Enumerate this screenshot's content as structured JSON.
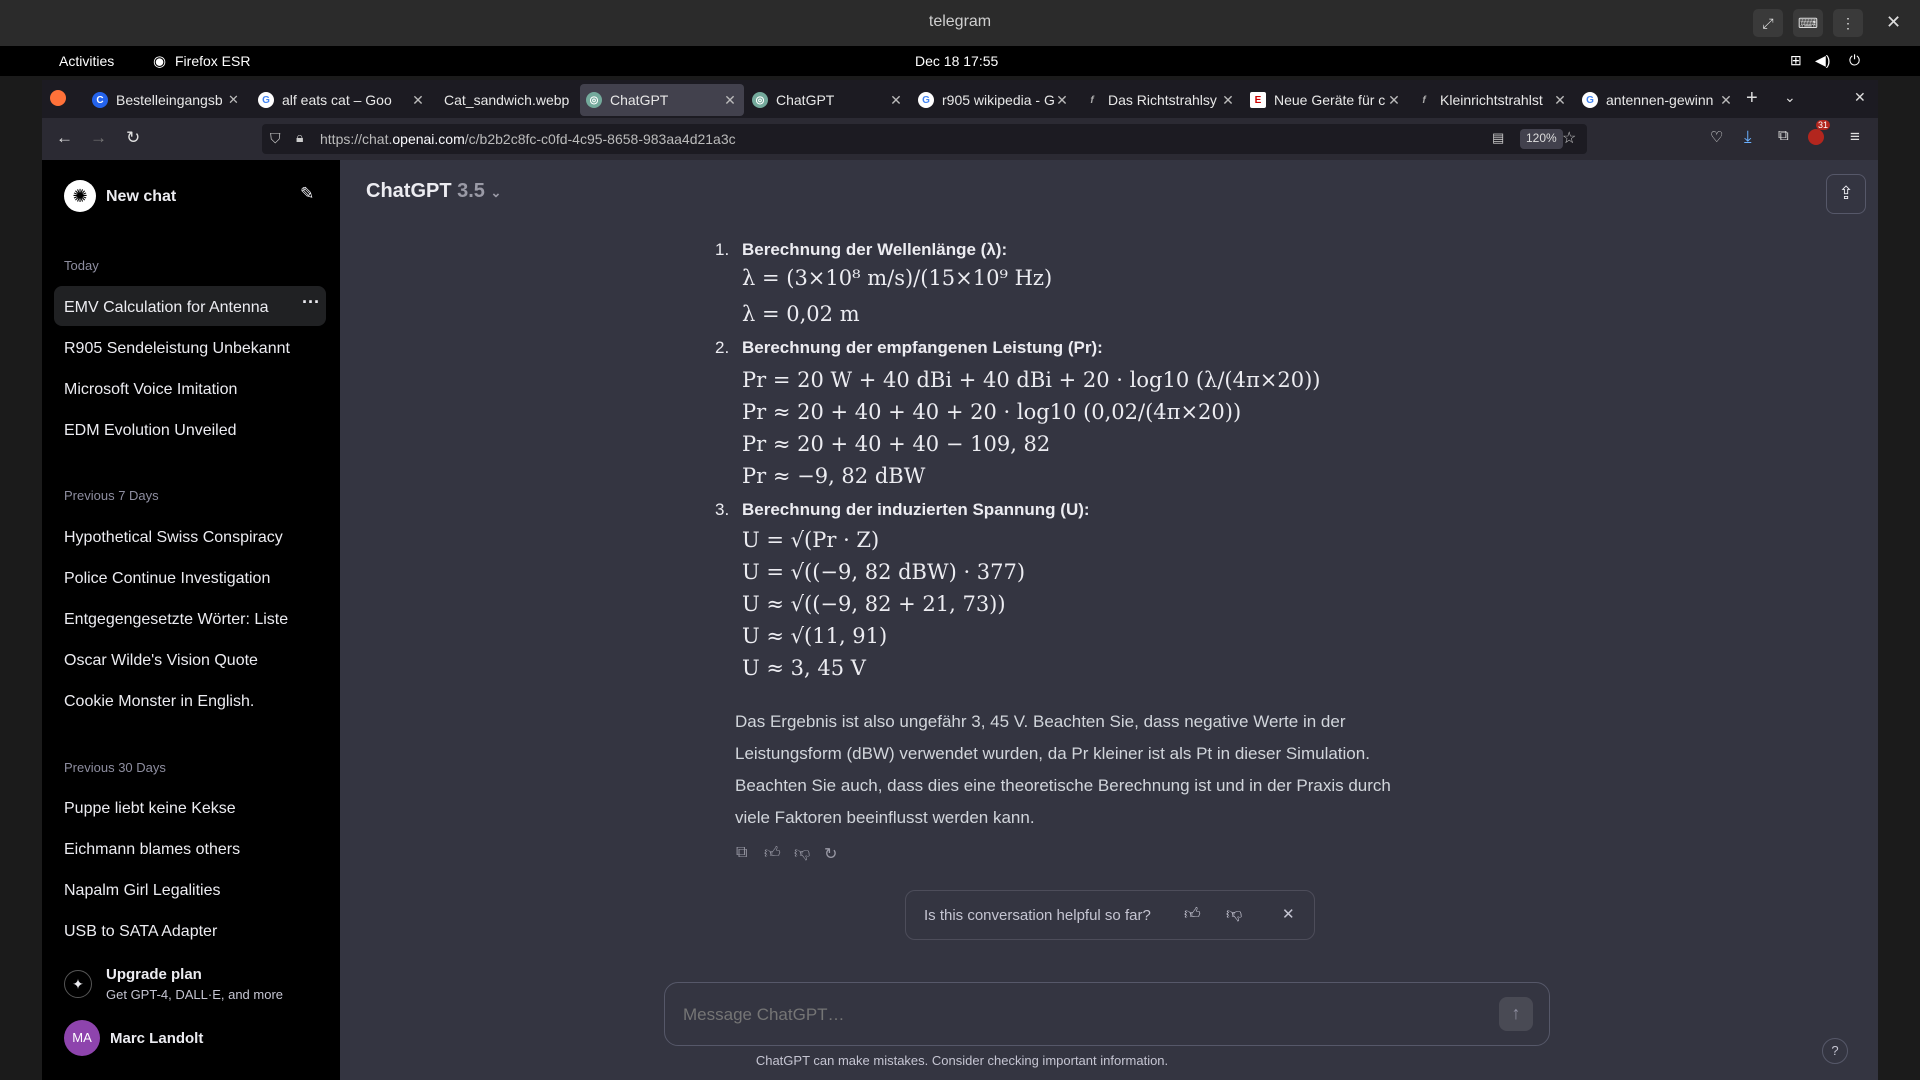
{
  "window": {
    "title": "telegram"
  },
  "gnome": {
    "activities": "Activities",
    "app": "Firefox ESR",
    "clock": "Dec 18  17:55"
  },
  "tabs": [
    {
      "label": "Bestelleingangsb",
      "icon": "firefox-icon"
    },
    {
      "label": "alf eats cat – Goo",
      "icon": "google-icon"
    },
    {
      "label": "Cat_sandwich.webp",
      "icon": "image-icon"
    },
    {
      "label": "ChatGPT",
      "icon": "chatgpt-icon",
      "active": true
    },
    {
      "label": "ChatGPT",
      "icon": "chatgpt-icon"
    },
    {
      "label": "r905 wikipedia - G",
      "icon": "google-icon"
    },
    {
      "label": "Das Richtstrahlsy",
      "icon": "f-icon"
    },
    {
      "label": "Neue Geräte für c",
      "icon": "e-icon"
    },
    {
      "label": "Kleinrichtstrahlst",
      "icon": "f-icon"
    },
    {
      "label": "antennen-gewinn",
      "icon": "google-icon"
    }
  ],
  "nav": {
    "url_prefix": "https://chat.",
    "url_host": "openai.com",
    "url_path": "/c/b2b2c8fc-c0fd-4c95-8658-983aa4d21a3c",
    "zoom": "120%",
    "badge": "31"
  },
  "sidebar": {
    "new_chat": "New chat",
    "sections": [
      {
        "heading": "Today",
        "items": [
          "EMV Calculation for Antenna",
          "R905 Sendeleistung Unbekannt",
          "Microsoft Voice Imitation",
          "EDM Evolution Unveiled"
        ]
      },
      {
        "heading": "Previous 7 Days",
        "items": [
          "Hypothetical Swiss Conspiracy",
          "Police Continue Investigation",
          "Entgegengesetzte Wörter: Liste",
          "Oscar Wilde's Vision Quote",
          "Cookie Monster in English."
        ]
      },
      {
        "heading": "Previous 30 Days",
        "items": [
          "Puppe liebt keine Kekse",
          "Eichmann blames others",
          "Napalm Girl Legalities",
          "USB to SATA Adapter"
        ]
      }
    ],
    "upgrade_title": "Upgrade plan",
    "upgrade_sub": "Get GPT-4, DALL·E, and more",
    "avatar_initials": "MA",
    "user_name": "Marc Landolt"
  },
  "header": {
    "model": "ChatGPT",
    "version": "3.5"
  },
  "steps": [
    {
      "num": "1.",
      "title": "Berechnung der Wellenlänge (λ):",
      "lines": [
        "λ = (3×10⁸ m/s)/(15×10⁹ Hz)",
        "λ = 0,02 m"
      ]
    },
    {
      "num": "2.",
      "title": "Berechnung der empfangenen Leistung (Pr):",
      "lines": [
        "Pr = 20 W + 40 dBi + 40 dBi + 20 · log10 (λ/(4π×20))",
        "Pr ≈ 20 + 40 + 40 + 20 · log10 (0,02/(4π×20))",
        "Pr ≈ 20 + 40 + 40 − 109, 82",
        "Pr ≈ −9, 82 dBW"
      ]
    },
    {
      "num": "3.",
      "title": "Berechnung der induzierten Spannung (U):",
      "lines": [
        "U = √(Pr · Z)",
        "U = √((−9, 82 dBW) · 377)",
        "U ≈ √((−9, 82 + 21, 73))",
        "U ≈ √(11, 91)",
        "U ≈ 3, 45 V"
      ]
    }
  ],
  "conclusion": [
    "Das Ergebnis ist also ungefähr 3, 45 V. Beachten Sie, dass negative Werte in der",
    "Leistungsform (dBW) verwendet wurden, da Pr kleiner ist als Pt in dieser Simulation.",
    "Beachten Sie auch, dass dies eine theoretische Berechnung ist und in der Praxis durch",
    "viele Faktoren beeinflusst werden kann."
  ],
  "feedback": {
    "question": "Is this conversation helpful so far?"
  },
  "composer": {
    "placeholder": "Message ChatGPT…"
  },
  "footer": {
    "disclaimer": "ChatGPT can make mistakes. Consider checking important information."
  }
}
